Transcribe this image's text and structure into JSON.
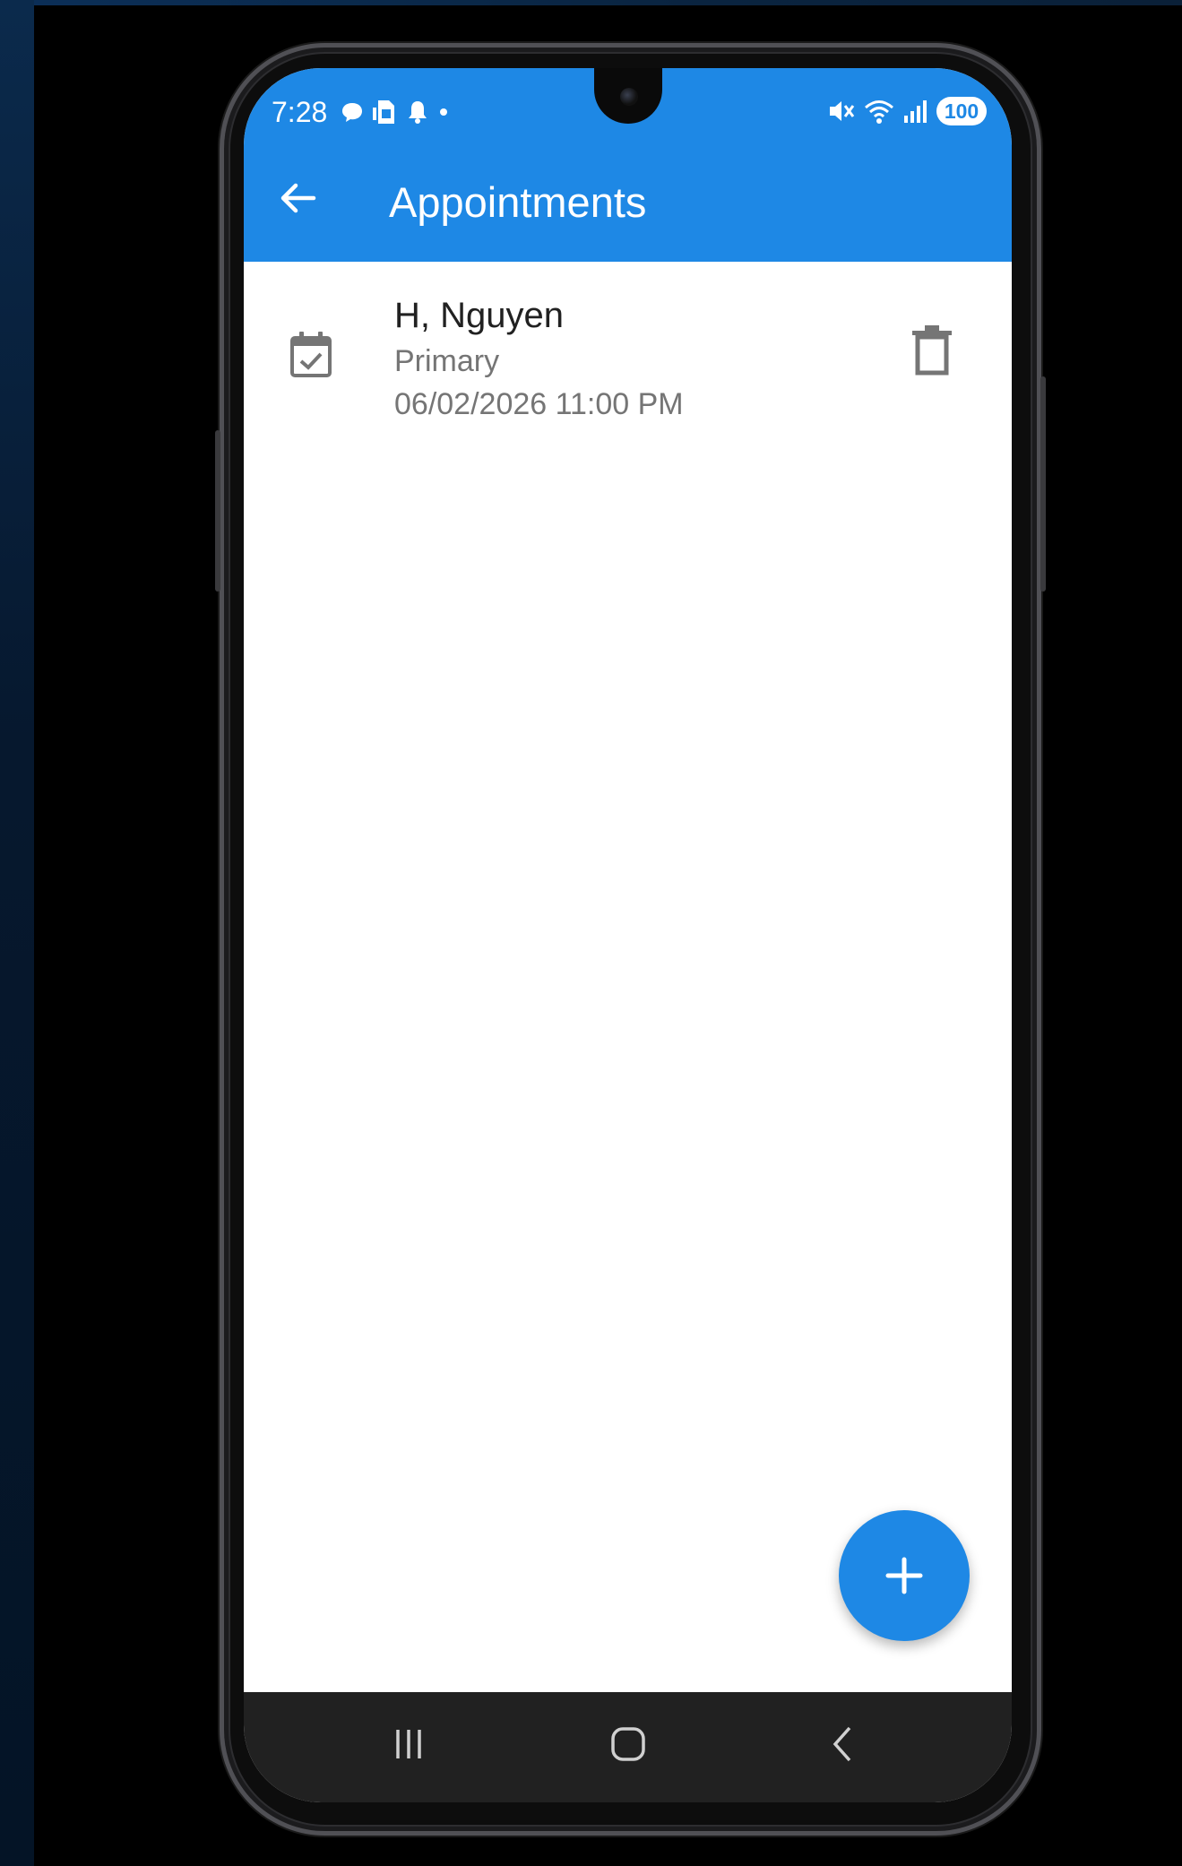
{
  "status_bar": {
    "time": "7:28",
    "battery": "100",
    "left_icons": [
      "chat-bubble-icon",
      "sim-card-icon",
      "bell-icon",
      "dot-icon"
    ],
    "right_icons": [
      "mute-icon",
      "wifi-icon",
      "signal-icon"
    ]
  },
  "app_bar": {
    "title": "Appointments",
    "color": "#1e88e5"
  },
  "appointments": [
    {
      "name": "H, Nguyen",
      "type": "Primary",
      "datetime": "06/02/2026 11:00 PM"
    }
  ],
  "colors": {
    "accent": "#1e88e5",
    "nav_bar": "#212121"
  }
}
